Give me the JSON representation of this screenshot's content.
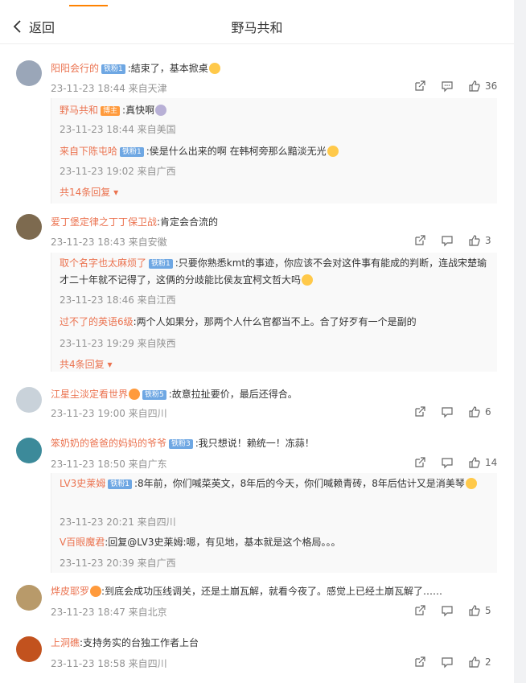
{
  "header": {
    "back_label": "返回",
    "title": "野马共和"
  },
  "comments": [
    {
      "name": "阳阳会行的",
      "badge": "铁粉1",
      "text": ":結束了，基本掀桌",
      "meta": "23-11-23 18:44 来自天津",
      "likes": "36",
      "replies": [
        {
          "name": "野马共和",
          "badge": "博主",
          "text": ":真快啊",
          "meta": "23-11-23 18:44 来自美国"
        },
        {
          "name": "来自下陈屯哈",
          "badge": "铁粉1",
          "text": ":侯是什么出来的啊 在韩柯旁那么黯淡无光",
          "meta": "23-11-23 19:02 来自广西"
        }
      ],
      "more": "共14条回复"
    },
    {
      "name": "爱丁堡定律之丁丁保卫战",
      "text": ":肯定会合流的",
      "meta": "23-11-23 18:43 来自安徽",
      "likes": "3",
      "replies": [
        {
          "name": "取个名字也太麻烦了",
          "badge": "铁粉1",
          "text": ":只要你熟悉kmt的事迹，你应该不会对这件事有能成的判断，连战宋楚瑜才二十年就不记得了，这俩的分歧能比侯友宜柯文哲大吗",
          "meta": "23-11-23 18:46 来自江西"
        },
        {
          "name": "过不了的英语6级",
          "text": ":两个人如果分，那两个人什么官都当不上。合了好歹有一个是副的",
          "meta": "23-11-23 19:29 来自陕西"
        }
      ],
      "more": "共4条回复"
    },
    {
      "name": "江星尘淡定看世界",
      "badge": "铁粉5",
      "text": ":故意拉扯要价，最后还得合。",
      "meta": "23-11-23 19:00 来自四川",
      "likes": "6"
    },
    {
      "name": "笨奶奶的爸爸的妈妈的爷爷",
      "badge": "铁粉3",
      "text": ":我只想说！赖统一！冻蒜！",
      "meta": "23-11-23 18:50 来自广东",
      "likes": "14",
      "replies": [
        {
          "name": "LV3史莱姆",
          "badge": "铁粉1",
          "text": ":8年前，你们喊菜英文，8年后的今天，你们喊赖青砖，8年后估计又是消美琴",
          "meta": "23-11-23 20:21 来自四川"
        },
        {
          "name": "V百眼魔君",
          "text": ":回复@LV3史莱姆:嗯，有见地，基本就是这个格局。。。",
          "meta": "23-11-23 20:39 来自广西"
        }
      ]
    },
    {
      "name": "烨皮耶罗",
      "text": ":到底会成功压线调关，还是土崩瓦解，就看今夜了。感觉上已经土崩瓦解了……",
      "meta": "23-11-23 18:47 来自北京",
      "likes": "5"
    },
    {
      "name": "上洞礁",
      "text": ":支持务实的台独工作者上台",
      "meta": "23-11-23 18:58 来自四川",
      "likes": "2"
    }
  ],
  "colors": {
    "accent": "#ff8200",
    "name": "#eb7350",
    "meta": "#939393"
  }
}
